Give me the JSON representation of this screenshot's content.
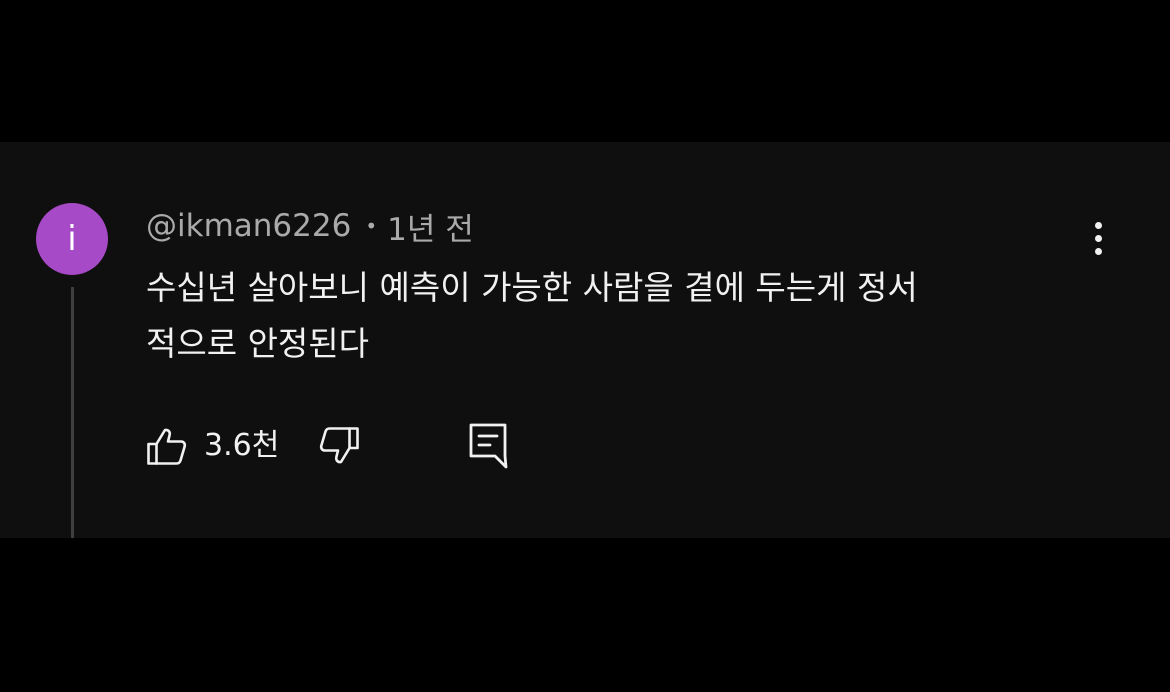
{
  "comment": {
    "avatar_letter": "i",
    "avatar_color": "#a74ac7",
    "author": "@ikman6226",
    "separator": "•",
    "time_ago": "1년 전",
    "text_line1": "수십년 살아보니 예측이 가능한 사람을 곁에 두는게 정서",
    "text_line2": "적으로 안정된다",
    "like_count": "3.6천",
    "icons": {
      "like": "thumbs-up-icon",
      "dislike": "thumbs-down-icon",
      "reply": "reply-comment-icon",
      "menu": "more-vertical-icon"
    }
  }
}
